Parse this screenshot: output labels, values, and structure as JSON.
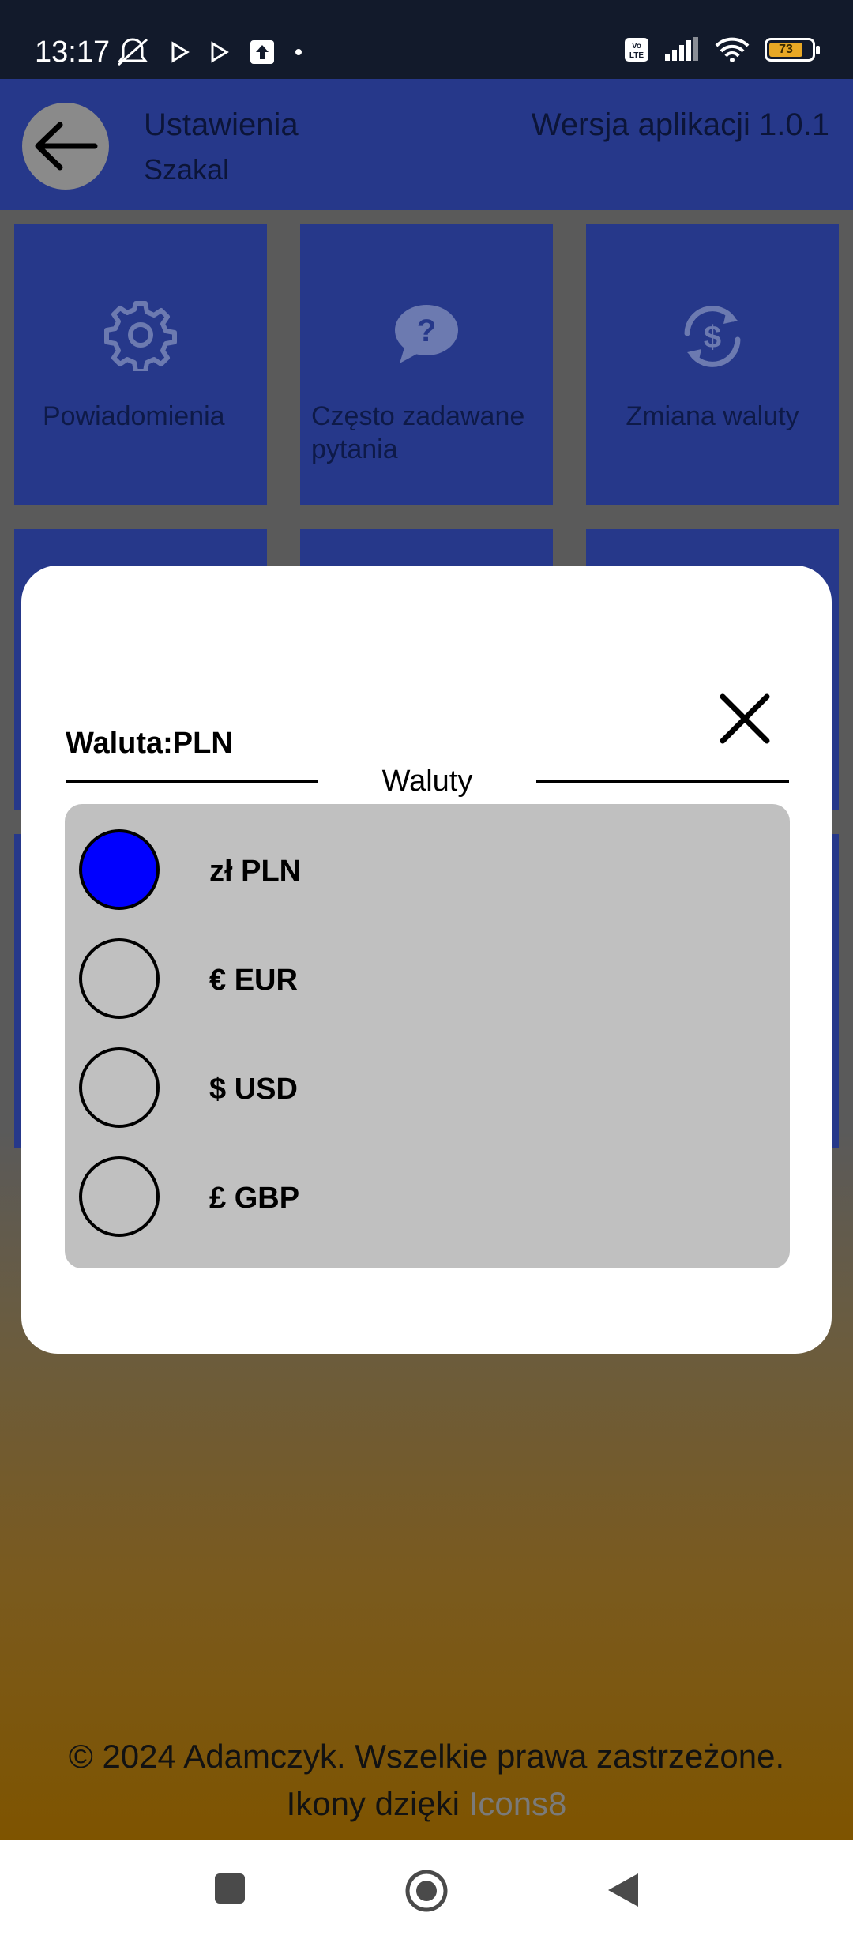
{
  "status_bar": {
    "time": "13:17",
    "battery_level": "73",
    "icons": [
      "mute-icon",
      "play-icon",
      "play-icon",
      "upload-icon",
      "dot-icon",
      "volte-icon",
      "signal-icon",
      "wifi-icon",
      "battery-icon"
    ]
  },
  "header": {
    "title": "Ustawienia",
    "subtitle": "Szakal",
    "version": "Wersja aplikacji 1.0.1"
  },
  "tiles": [
    {
      "label": "Powiadomienia",
      "icon": "gear-icon"
    },
    {
      "label": "Często zadawane pytania",
      "icon": "question-bubble-icon"
    },
    {
      "label": "Zmiana waluty",
      "icon": "currency-exchange-icon"
    }
  ],
  "modal": {
    "title": "Waluta:PLN",
    "section_label": "Waluty",
    "options": [
      {
        "label": "zł PLN",
        "selected": true
      },
      {
        "label": "€ EUR",
        "selected": false
      },
      {
        "label": "$ USD",
        "selected": false
      },
      {
        "label": "£ GBP",
        "selected": false
      }
    ],
    "selected_color": "#0000ff"
  },
  "footer": {
    "copyright": "© 2024 Adamczyk. Wszelkie prawa zastrzeżone.",
    "credit_prefix": "Ikony dzięki ",
    "credit_link": "Icons8"
  },
  "colors": {
    "header_bg": "#26388a",
    "status_bar_bg": "#121a2b"
  }
}
